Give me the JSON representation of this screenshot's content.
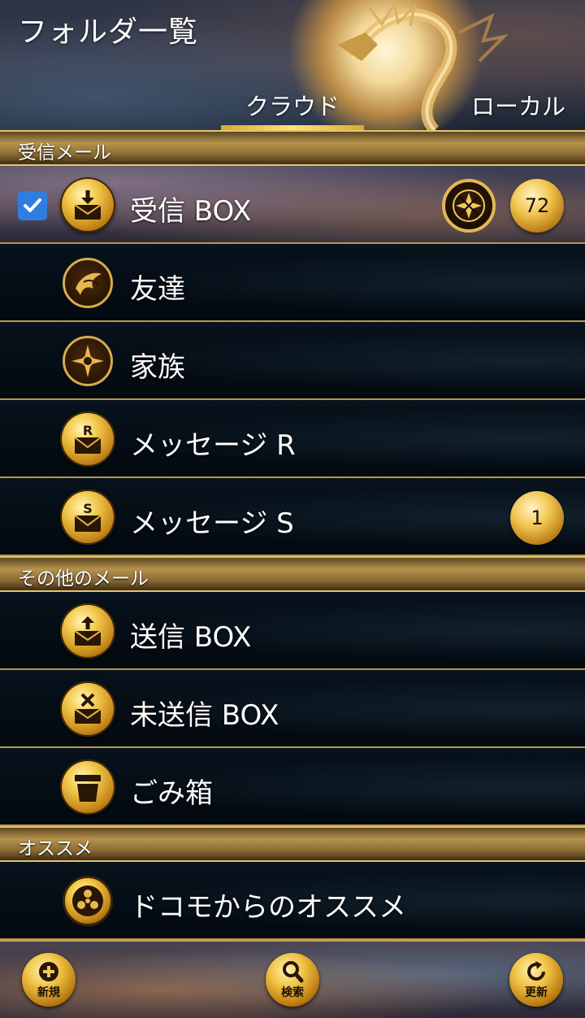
{
  "header": {
    "title": "フォルダ一覧",
    "tabs": [
      {
        "label": "クラウド",
        "active": true
      },
      {
        "label": "ローカル",
        "active": false
      }
    ]
  },
  "sections": {
    "inbox": {
      "label": "受信メール",
      "items": [
        {
          "label": "受信 BOX",
          "icon": "inbox-download-icon",
          "checked": true,
          "count": "72",
          "crest": "kamon-crest-icon"
        },
        {
          "label": "友達",
          "icon": "phoenix-emblem-icon"
        },
        {
          "label": "家族",
          "icon": "star-emblem-icon"
        },
        {
          "label": "メッセージ R",
          "icon": "envelope-r-icon"
        },
        {
          "label": "メッセージ S",
          "icon": "envelope-s-icon",
          "count": "1"
        }
      ]
    },
    "other": {
      "label": "その他のメール",
      "items": [
        {
          "label": "送信 BOX",
          "icon": "outbox-upload-icon"
        },
        {
          "label": "未送信 BOX",
          "icon": "unsent-envelope-icon"
        },
        {
          "label": "ごみ箱",
          "icon": "trash-bin-icon"
        }
      ]
    },
    "recommend": {
      "label": "オススメ",
      "items": [
        {
          "label": "ドコモからのオススメ",
          "icon": "mitsudomoe-emblem-icon"
        }
      ]
    }
  },
  "footer": {
    "new_label": "新規",
    "search_label": "検索",
    "refresh_label": "更新"
  },
  "colors": {
    "gold": "#e6c46a",
    "checkbox": "#2f7de1",
    "row_bg": "#03090f"
  }
}
